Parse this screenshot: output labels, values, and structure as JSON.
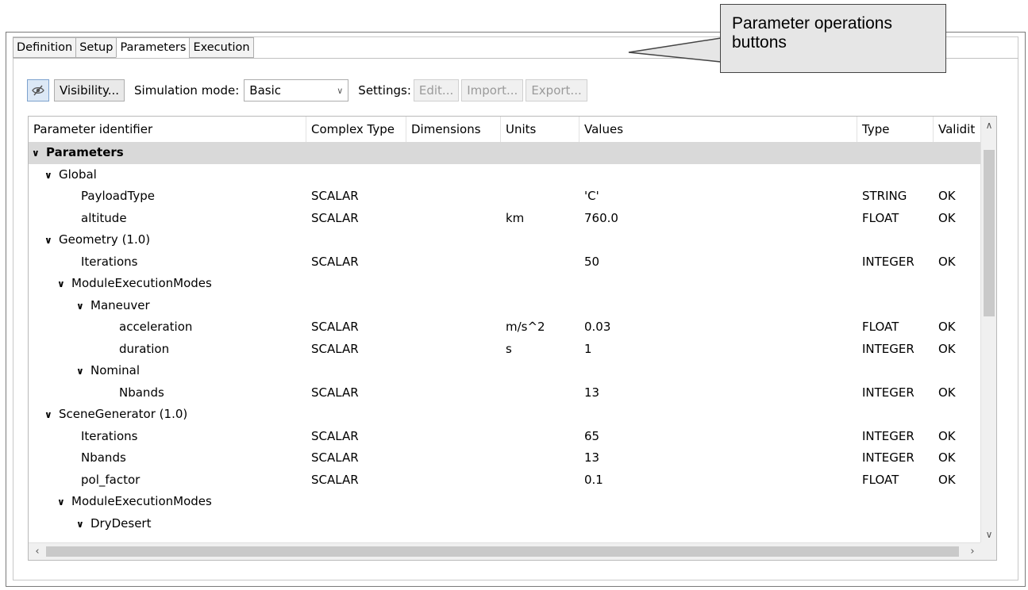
{
  "tabs": [
    "Definition",
    "Setup",
    "Parameters",
    "Execution"
  ],
  "active_tab": "Parameters",
  "toolbar": {
    "visibility_label": "Visibility...",
    "sim_mode_label": "Simulation mode:",
    "sim_mode_value": "Basic",
    "settings_label": "Settings:",
    "edit_label": "Edit...",
    "import_label": "Import...",
    "export_label": "Export..."
  },
  "columns": [
    "Parameter identifier",
    "Complex Type",
    "Dimensions",
    "Units",
    "Values",
    "Type",
    "Validit"
  ],
  "rows": [
    {
      "level": 0,
      "expand": true,
      "name": "Parameters",
      "bold": true,
      "complex": "",
      "dims": "",
      "units": "",
      "value": "",
      "type": "",
      "valid": ""
    },
    {
      "level": 1,
      "expand": true,
      "name": "Global",
      "complex": "",
      "dims": "",
      "units": "",
      "value": "",
      "type": "",
      "valid": ""
    },
    {
      "level": 2,
      "expand": false,
      "name": "PayloadType",
      "complex": "SCALAR",
      "dims": "",
      "units": "",
      "value": "'C'",
      "type": "STRING",
      "valid": "OK"
    },
    {
      "level": 2,
      "expand": false,
      "name": "altitude",
      "complex": "SCALAR",
      "dims": "",
      "units": "km",
      "value": "760.0",
      "type": "FLOAT",
      "valid": "OK"
    },
    {
      "level": 1,
      "expand": true,
      "name": "Geometry (1.0)",
      "complex": "",
      "dims": "",
      "units": "",
      "value": "",
      "type": "",
      "valid": ""
    },
    {
      "level": 2,
      "expand": false,
      "name": "Iterations",
      "complex": "SCALAR",
      "dims": "",
      "units": "",
      "value": "50",
      "type": "INTEGER",
      "valid": "OK"
    },
    {
      "level": 2,
      "expand": true,
      "name": "ModuleExecutionModes",
      "complex": "",
      "dims": "",
      "units": "",
      "value": "",
      "type": "",
      "valid": ""
    },
    {
      "level": 3,
      "expand": true,
      "name": "Maneuver",
      "complex": "",
      "dims": "",
      "units": "",
      "value": "",
      "type": "",
      "valid": ""
    },
    {
      "level": 4,
      "expand": false,
      "name": "acceleration",
      "complex": "SCALAR",
      "dims": "",
      "units": "m/s^2",
      "value": "0.03",
      "type": "FLOAT",
      "valid": "OK"
    },
    {
      "level": 4,
      "expand": false,
      "name": "duration",
      "complex": "SCALAR",
      "dims": "",
      "units": "s",
      "value": "1",
      "type": "INTEGER",
      "valid": "OK"
    },
    {
      "level": 3,
      "expand": true,
      "name": "Nominal",
      "complex": "",
      "dims": "",
      "units": "",
      "value": "",
      "type": "",
      "valid": ""
    },
    {
      "level": 4,
      "expand": false,
      "name": "Nbands",
      "complex": "SCALAR",
      "dims": "",
      "units": "",
      "value": "13",
      "type": "INTEGER",
      "valid": "OK"
    },
    {
      "level": 1,
      "expand": true,
      "name": "SceneGenerator (1.0)",
      "complex": "",
      "dims": "",
      "units": "",
      "value": "",
      "type": "",
      "valid": ""
    },
    {
      "level": 2,
      "expand": false,
      "name": "Iterations",
      "complex": "SCALAR",
      "dims": "",
      "units": "",
      "value": "65",
      "type": "INTEGER",
      "valid": "OK"
    },
    {
      "level": 2,
      "expand": false,
      "name": "Nbands",
      "complex": "SCALAR",
      "dims": "",
      "units": "",
      "value": "13",
      "type": "INTEGER",
      "valid": "OK"
    },
    {
      "level": 2,
      "expand": false,
      "name": "pol_factor",
      "complex": "SCALAR",
      "dims": "",
      "units": "",
      "value": "0.1",
      "type": "FLOAT",
      "valid": "OK"
    },
    {
      "level": 2,
      "expand": true,
      "name": "ModuleExecutionModes",
      "complex": "",
      "dims": "",
      "units": "",
      "value": "",
      "type": "",
      "valid": ""
    },
    {
      "level": 3,
      "expand": true,
      "name": "DryDesert",
      "complex": "",
      "dims": "",
      "units": "",
      "value": "",
      "type": "",
      "valid": ""
    }
  ],
  "callout": {
    "text": "Parameter operations buttons"
  }
}
